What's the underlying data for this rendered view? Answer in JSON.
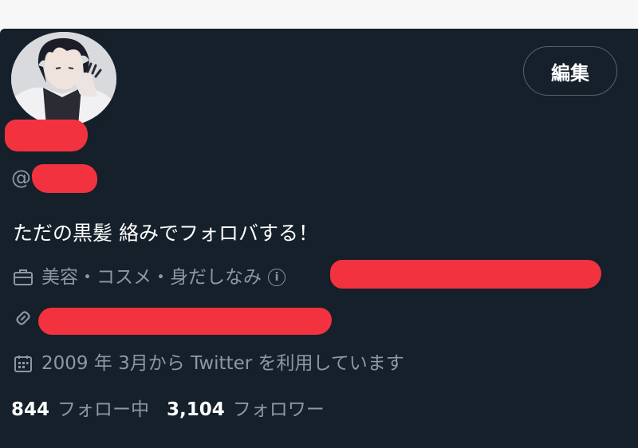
{
  "profile": {
    "edit_label": "編集",
    "handle_prefix": "@",
    "bio": "ただの黒髪 絡みでフォロバする！",
    "category": "美容・コスメ・身だしなみ",
    "info_icon": "i",
    "joined": "2009 年 3月から Twitter を利用しています",
    "following_count": "844",
    "following_label": "フォロー中",
    "followers_count": "3,104",
    "followers_label": "フォロワー"
  },
  "icons": {
    "category": "briefcase-icon",
    "link": "link-icon",
    "joined": "calendar-icon",
    "info": "info-icon"
  },
  "colors": {
    "background": "#15202b",
    "text_primary": "#ffffff",
    "text_secondary": "#8b98a5",
    "redaction": "#f2333f",
    "button_border": "#56626d"
  }
}
